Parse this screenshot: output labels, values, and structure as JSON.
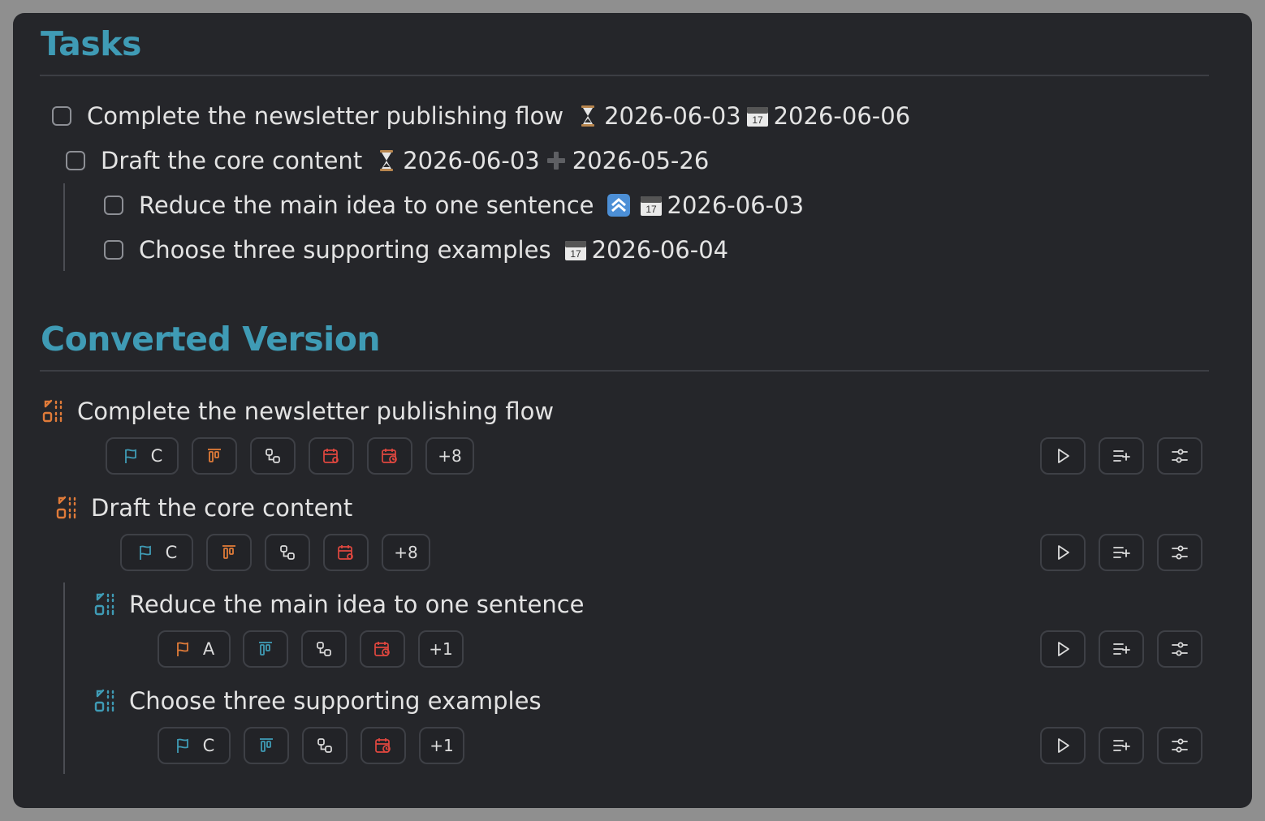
{
  "sections": {
    "tasks_heading": "Tasks",
    "converted_heading": "Converted Version"
  },
  "md_tasks": [
    {
      "text": "Complete the newsletter publishing flow",
      "tokens": [
        {
          "icon": "hourglass-icon",
          "date": "2026-06-03"
        },
        {
          "icon": "calendar-icon",
          "date": "2026-06-06"
        }
      ]
    },
    {
      "text": "Draft the core content",
      "tokens": [
        {
          "icon": "hourglass-icon",
          "date": "2026-06-03"
        },
        {
          "icon": "plus-icon",
          "date": "2026-05-26"
        }
      ]
    },
    {
      "text": "Reduce the main idea to one sentence",
      "tokens": [
        {
          "icon": "double-up-arrow-icon",
          "date": ""
        },
        {
          "icon": "calendar-icon",
          "date": "2026-06-03"
        }
      ]
    },
    {
      "text": "Choose three supporting examples",
      "tokens": [
        {
          "icon": "calendar-icon",
          "date": "2026-06-04"
        }
      ]
    }
  ],
  "converted_tasks": [
    {
      "title": "Complete the newsletter publishing flow",
      "icon_color": "#e07b39",
      "priority": "C",
      "priority_color": "#3f9bb5",
      "more": "+8"
    },
    {
      "title": "Draft the core content",
      "icon_color": "#e07b39",
      "priority": "C",
      "priority_color": "#3f9bb5",
      "more": "+8"
    },
    {
      "title": "Reduce the main idea to one sentence",
      "icon_color": "#3f9bb5",
      "priority": "A",
      "priority_color": "#e07b39",
      "more": "+1"
    },
    {
      "title": "Choose three supporting examples",
      "icon_color": "#3f9bb5",
      "priority": "C",
      "priority_color": "#3f9bb5",
      "more": "+1"
    }
  ],
  "colors": {
    "accent": "#3f9bb5",
    "orange": "#e07b39",
    "red": "#e0473f"
  }
}
